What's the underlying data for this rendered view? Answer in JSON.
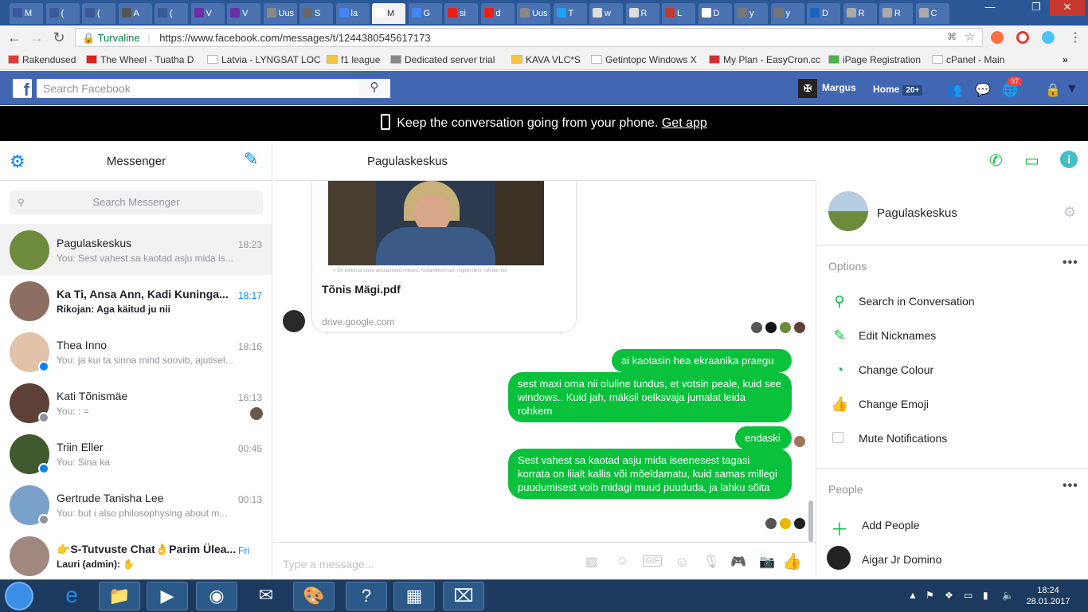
{
  "browser": {
    "tabs": [
      {
        "label": "M",
        "color": "#3b5998"
      },
      {
        "label": "(",
        "color": "#3b5998"
      },
      {
        "label": "(",
        "color": "#3b5998"
      },
      {
        "label": "A",
        "color": "#555555"
      },
      {
        "label": "(",
        "color": "#3b5998"
      },
      {
        "label": "V",
        "color": "#6b2fa6"
      },
      {
        "label": "V",
        "color": "#6b2fa6"
      },
      {
        "label": "Uus",
        "color": "#888888"
      },
      {
        "label": "S",
        "color": "#666666"
      },
      {
        "label": "la",
        "color": "#4285f4"
      },
      {
        "label": "M",
        "color": "#ffffff"
      },
      {
        "label": "G",
        "color": "#4285f4"
      },
      {
        "label": "si",
        "color": "#e62117"
      },
      {
        "label": "d",
        "color": "#e62117"
      },
      {
        "label": "Uus",
        "color": "#888888"
      },
      {
        "label": "T",
        "color": "#1da1f2"
      },
      {
        "label": "w",
        "color": "#dddddd"
      },
      {
        "label": "R",
        "color": "#dddddd"
      },
      {
        "label": "L",
        "color": "#c0392b"
      },
      {
        "label": "D",
        "color": "#ffffff"
      },
      {
        "label": "y",
        "color": "#777777"
      },
      {
        "label": "y",
        "color": "#777777"
      },
      {
        "label": "D",
        "color": "#1565c0"
      },
      {
        "label": "R",
        "color": "#aaaaaa"
      },
      {
        "label": "R",
        "color": "#aaaaaa"
      },
      {
        "label": "C",
        "color": "#aaaaaa"
      }
    ],
    "active_tab_index": 10,
    "secure_label": "Turvaline",
    "url": "https://www.facebook.com/messages/t/1244380545617173",
    "bookmarks": [
      {
        "label": "Rakendused",
        "color": "#e53935"
      },
      {
        "label": "The Wheel - Tuatha D",
        "color": "#e62117"
      },
      {
        "label": "Latvia - LYNGSAT LOC",
        "color": "#ffffff"
      },
      {
        "label": "f1 league",
        "color": "#f6c342"
      },
      {
        "label": "Dedicated server trial",
        "color": "#888888"
      },
      {
        "label": "KAVA VLC*S",
        "color": "#f6c342"
      },
      {
        "label": "Getintopc Windows X",
        "color": "#ffffff"
      },
      {
        "label": "My Plan - EasyCron.cc",
        "color": "#d32f2f"
      },
      {
        "label": "iPage Registration",
        "color": "#4caf50"
      },
      {
        "label": "cPanel - Main",
        "color": "#ffffff"
      }
    ],
    "more_bookmarks": "»"
  },
  "facebook": {
    "search_placeholder": "Search Facebook",
    "user_name": "Margus",
    "home_label": "Home",
    "home_badge": "20+",
    "notif_count": "97",
    "banner_text": "Keep the conversation going from your phone.",
    "banner_link": "Get app"
  },
  "messenger": {
    "title": "Messenger",
    "search_placeholder": "Search Messenger",
    "threads": [
      {
        "name": "Pagulaskeskus",
        "snippet": "You: Sest vahest sa kaotad asju mida is...",
        "time": "18:23",
        "unread": false,
        "active": true,
        "avatar_color": "#6e8a3d",
        "badge": ""
      },
      {
        "name": "Ka Ti, Ansa Ann, Kadi Kuninga...",
        "snippet": "Rikojan: Aga käitud ju nii",
        "time": "18:17",
        "unread": true,
        "active": false,
        "avatar_color": "#8d6e63",
        "badge": ""
      },
      {
        "name": "Thea Inno",
        "snippet": "You: ja kui ta sinna mind soovib, ajutisel...",
        "time": "18:16",
        "unread": false,
        "active": false,
        "avatar_color": "#e0c3a8",
        "badge": "messenger"
      },
      {
        "name": "Kati Tõnismäe",
        "snippet": "You: : =",
        "time": "16:13",
        "unread": false,
        "active": false,
        "avatar_color": "#5d4037",
        "badge": "facebook"
      },
      {
        "name": "Triin Eller",
        "snippet": "You: Sina ka",
        "time": "00:45",
        "unread": false,
        "active": false,
        "avatar_color": "#3e5a2e",
        "badge": "messenger"
      },
      {
        "name": "Gertrude Tanisha Lee",
        "snippet": "You: but i also philosophysing about m...",
        "time": "00:13",
        "unread": false,
        "active": false,
        "avatar_color": "#7aa1c9",
        "badge": "facebook"
      },
      {
        "name": "👉S-Tutvuste Chat👌Parim Ülea...",
        "snippet": "Lauri (admin): ✋",
        "time": "Fri",
        "unread": true,
        "active": false,
        "avatar_color": "#a1887f",
        "badge": ""
      }
    ]
  },
  "conversation": {
    "title": "Pagulaskeskus",
    "attachment_caption": "« On tekkinud uued ausaamised niiliuest, kodanikkonnast, riigipiiridest, rahvast kui",
    "attachment_name": "Tõnis Mägi.pdf",
    "attachment_source": "drive.google.com",
    "messages": [
      {
        "text": "ai kaotasin hea ekraanika praegu"
      },
      {
        "text": "sest maxi oma nii oluline tundus, et votsin peale, kuid see windows.. Kuid jah, mäksil oelksvaja jumalat leida rohkem"
      },
      {
        "text": "endaski"
      },
      {
        "text": "Sest vahest sa kaotad asju mida iseenesest tagasi korrata on liialt kallis või mõeldamatu, kuid samas millegi puudumisest voib midagi muud puududa, ja lahku sõita"
      }
    ],
    "composer_placeholder": "Type a message...",
    "bubble_color": "#09c13b"
  },
  "details": {
    "name": "Pagulaskeskus",
    "options_label": "Options",
    "options": [
      {
        "label": "Search in Conversation",
        "icon": "search-icon"
      },
      {
        "label": "Edit Nicknames",
        "icon": "pencil-icon"
      },
      {
        "label": "Change Colour",
        "icon": "palette-icon"
      },
      {
        "label": "Change Emoji",
        "icon": "thumbs-up-icon"
      },
      {
        "label": "Mute Notifications",
        "icon": "checkbox"
      }
    ],
    "people_label": "People",
    "add_people": "Add People",
    "people": [
      {
        "name": "Aigar Jr Domino"
      }
    ]
  },
  "taskbar": {
    "time": "18:24",
    "date": "28.01.2017"
  }
}
